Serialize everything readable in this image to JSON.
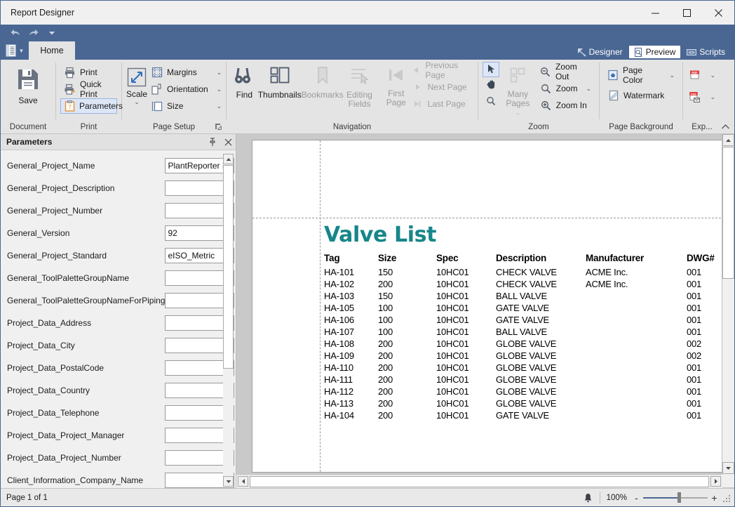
{
  "window": {
    "title": "Report Designer",
    "minimize_label": "Minimize",
    "maximize_label": "Maximize",
    "close_label": "Close"
  },
  "quick_access": {
    "undo_label": "Undo",
    "redo_label": "Redo",
    "more_label": "Customize Quick Access Toolbar"
  },
  "tabs": {
    "app_menu_label": "File",
    "items": [
      {
        "label": "Home",
        "active": true
      }
    ]
  },
  "view_buttons": [
    {
      "label": "Designer",
      "icon": "designer-icon",
      "active": false
    },
    {
      "label": "Preview",
      "icon": "preview-icon",
      "active": true
    },
    {
      "label": "Scripts",
      "icon": "scripts-icon",
      "active": false
    }
  ],
  "ribbon": {
    "groups": [
      {
        "name": "Document",
        "label": "Document",
        "buttons": [
          {
            "label": "Save",
            "icon": "save-icon"
          }
        ]
      },
      {
        "name": "Print",
        "label": "Print",
        "buttons": [
          {
            "label": "Print",
            "icon": "print-icon",
            "selected": false
          },
          {
            "label": "Quick Print",
            "icon": "quick-print-icon",
            "selected": false
          },
          {
            "label": "Parameters",
            "icon": "parameters-icon",
            "selected": true
          }
        ]
      },
      {
        "name": "Page Setup",
        "label": "Page Setup",
        "scale_label": "Scale",
        "buttons": [
          {
            "label": "Margins",
            "icon": "margins-icon",
            "dropdown": true
          },
          {
            "label": "Orientation",
            "icon": "orientation-icon",
            "dropdown": true
          },
          {
            "label": "Size",
            "icon": "size-icon",
            "dropdown": true
          }
        ]
      },
      {
        "name": "Navigation",
        "label": "Navigation",
        "big_buttons": [
          {
            "label": "Find",
            "icon": "find-icon",
            "disabled": false
          },
          {
            "label": "Thumbnails",
            "icon": "thumbnails-icon",
            "disabled": false
          },
          {
            "label": "Bookmarks",
            "icon": "bookmarks-icon",
            "disabled": true
          },
          {
            "label": "Editing Fields",
            "icon": "editing-fields-icon",
            "disabled": true
          },
          {
            "label": "First Page",
            "icon": "first-page-icon",
            "disabled": true
          }
        ],
        "small_buttons": [
          {
            "label": "Previous Page",
            "icon": "previous-page-icon",
            "disabled": true
          },
          {
            "label": "Next  Page",
            "icon": "next-page-icon",
            "disabled": true
          },
          {
            "label": "Last  Page",
            "icon": "last-page-icon",
            "disabled": true
          }
        ]
      },
      {
        "name": "Zoom",
        "label": "Zoom",
        "many_pages_label": "Many Pages",
        "tools": [
          {
            "label": "Pointer",
            "icon": "pointer-icon",
            "selected": true
          },
          {
            "label": "Hand",
            "icon": "hand-icon",
            "selected": false
          },
          {
            "label": "Magnifier",
            "icon": "magnifier-icon",
            "selected": false
          }
        ],
        "buttons": [
          {
            "label": "Zoom Out",
            "icon": "zoom-out-icon",
            "dropdown": false
          },
          {
            "label": "Zoom",
            "icon": "zoom-icon",
            "dropdown": true
          },
          {
            "label": "Zoom In",
            "icon": "zoom-in-icon",
            "dropdown": false
          }
        ]
      },
      {
        "name": "Page Background",
        "label": "Page Background",
        "buttons": [
          {
            "label": "Page Color",
            "icon": "page-color-icon",
            "dropdown": true
          },
          {
            "label": "Watermark",
            "icon": "watermark-icon",
            "dropdown": false
          }
        ]
      },
      {
        "name": "Export",
        "label": "Exp...",
        "buttons": [
          {
            "label": "Export To",
            "icon": "export-pdf-icon",
            "dropdown": true
          },
          {
            "label": "Send Via E-Mail",
            "icon": "email-pdf-icon",
            "dropdown": true
          }
        ],
        "collapse_label": "Collapse the Ribbon"
      }
    ]
  },
  "parameters_panel": {
    "title": "Parameters",
    "pin_label": "Auto Hide",
    "close_label": "Close",
    "rows": [
      {
        "name": "General_Project_Name",
        "value": "PlantReporter Exa"
      },
      {
        "name": "General_Project_Description",
        "value": ""
      },
      {
        "name": "General_Project_Number",
        "value": ""
      },
      {
        "name": "General_Version",
        "value": "92"
      },
      {
        "name": "General_Project_Standard",
        "value": "eISO_Metric"
      },
      {
        "name": "General_ToolPaletteGroupName",
        "value": ""
      },
      {
        "name": "General_ToolPaletteGroupNameForPiping",
        "value": ""
      },
      {
        "name": "Project_Data_Address",
        "value": ""
      },
      {
        "name": "Project_Data_City",
        "value": ""
      },
      {
        "name": "Project_Data_PostalCode",
        "value": ""
      },
      {
        "name": "Project_Data_Country",
        "value": ""
      },
      {
        "name": "Project_Data_Telephone",
        "value": ""
      },
      {
        "name": "Project_Data_Project_Manager",
        "value": ""
      },
      {
        "name": "Project_Data_Project_Number",
        "value": ""
      },
      {
        "name": "Client_Information_Company_Name",
        "value": ""
      }
    ]
  },
  "report": {
    "title": "Valve List",
    "title_color": "#17868a",
    "columns": [
      "Tag",
      "Size",
      "Spec",
      "Description",
      "Manufacturer",
      "DWG#"
    ],
    "rows": [
      [
        "HA-101",
        "150",
        "10HC01",
        "CHECK VALVE",
        "ACME Inc.",
        "001"
      ],
      [
        "HA-102",
        "200",
        "10HC01",
        "CHECK VALVE",
        "ACME Inc.",
        "001"
      ],
      [
        "HA-103",
        "150",
        "10HC01",
        "BALL VALVE",
        "",
        "001"
      ],
      [
        "HA-105",
        "100",
        "10HC01",
        "GATE VALVE",
        "",
        "001"
      ],
      [
        "HA-106",
        "100",
        "10HC01",
        "GATE VALVE",
        "",
        "001"
      ],
      [
        "HA-107",
        "100",
        "10HC01",
        "BALL VALVE",
        "",
        "001"
      ],
      [
        "HA-108",
        "200",
        "10HC01",
        "GLOBE VALVE",
        "",
        "002"
      ],
      [
        "HA-109",
        "200",
        "10HC01",
        "GLOBE VALVE",
        "",
        "002"
      ],
      [
        "HA-110",
        "200",
        "10HC01",
        "GLOBE VALVE",
        "",
        "001"
      ],
      [
        "HA-111",
        "200",
        "10HC01",
        "GLOBE VALVE",
        "",
        "001"
      ],
      [
        "HA-112",
        "200",
        "10HC01",
        "GLOBE VALVE",
        "",
        "001"
      ],
      [
        "HA-113",
        "200",
        "10HC01",
        "GLOBE VALVE",
        "",
        "001"
      ],
      [
        "HA-104",
        "200",
        "10HC01",
        "GATE VALVE",
        "",
        "001"
      ]
    ]
  },
  "status_bar": {
    "page_info": "Page 1 of 1",
    "notification_label": "Notifications",
    "zoom_level": "100%",
    "zoom_out_label": "-",
    "zoom_in_label": "+"
  },
  "colors": {
    "ribbon_blue": "#4a6793",
    "accent_teal": "#17868a",
    "selection_blue": "#dce6f7"
  }
}
